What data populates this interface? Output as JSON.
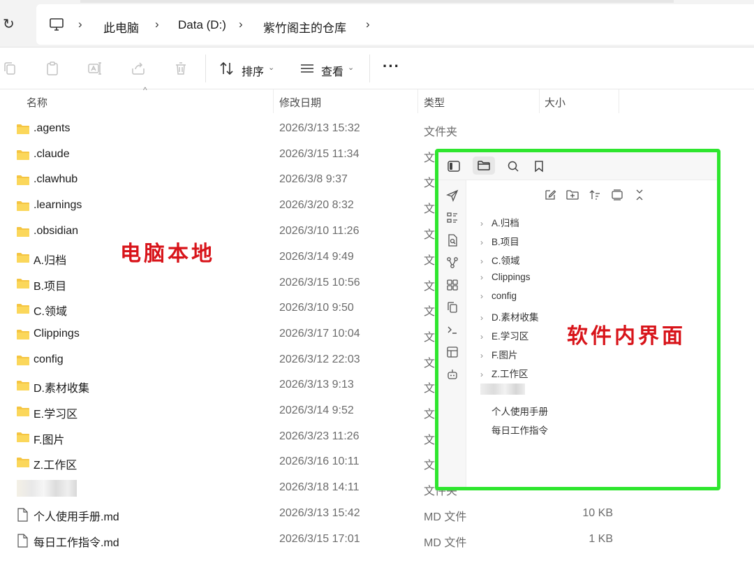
{
  "address": {
    "crumbs": [
      "此电脑",
      "Data (D:)",
      "紫竹阁主的仓库"
    ]
  },
  "toolbar": {
    "sort_label": "排序",
    "view_label": "查看"
  },
  "columns": {
    "name": "名称",
    "modified": "修改日期",
    "type": "类型",
    "size": "大小"
  },
  "rows": [
    {
      "name": ".agents",
      "date": "2026/3/13 15:32",
      "type": "文件夹",
      "size": ""
    },
    {
      "name": ".claude",
      "date": "2026/3/15 11:34",
      "type": "文",
      "size": ""
    },
    {
      "name": ".clawhub",
      "date": "2026/3/8 9:37",
      "type": "文",
      "size": ""
    },
    {
      "name": ".learnings",
      "date": "2026/3/20 8:32",
      "type": "文",
      "size": ""
    },
    {
      "name": ".obsidian",
      "date": "2026/3/10 11:26",
      "type": "文",
      "size": ""
    },
    {
      "name": "A.归档",
      "date": "2026/3/14 9:49",
      "type": "文",
      "size": ""
    },
    {
      "name": "B.项目",
      "date": "2026/3/15 10:56",
      "type": "文",
      "size": ""
    },
    {
      "name": "C.领域",
      "date": "2026/3/10 9:50",
      "type": "文",
      "size": ""
    },
    {
      "name": "Clippings",
      "date": "2026/3/17 10:04",
      "type": "文",
      "size": ""
    },
    {
      "name": "config",
      "date": "2026/3/12 22:03",
      "type": "文",
      "size": ""
    },
    {
      "name": "D.素材收集",
      "date": "2026/3/13 9:13",
      "type": "文",
      "size": ""
    },
    {
      "name": "E.学习区",
      "date": "2026/3/14 9:52",
      "type": "文",
      "size": ""
    },
    {
      "name": "F.图片",
      "date": "2026/3/23 11:26",
      "type": "文",
      "size": ""
    },
    {
      "name": "Z.工作区",
      "date": "2026/3/16 10:11",
      "type": "文",
      "size": ""
    },
    {
      "name": "",
      "date": "2026/3/18 14:11",
      "type": "文件夹",
      "size": ""
    },
    {
      "name": "个人使用手册.md",
      "date": "2026/3/13 15:42",
      "type": "MD 文件",
      "size": "10 KB"
    },
    {
      "name": "每日工作指令.md",
      "date": "2026/3/15 17:01",
      "type": "MD 文件",
      "size": "1 KB"
    }
  ],
  "annotations": {
    "local": "电脑本地",
    "app": "软件内界面"
  },
  "overlay": {
    "folders": [
      "A.归档",
      "B.项目",
      "C.领域",
      "Clippings",
      "config",
      "D.素材收集",
      "E.学习区",
      "F.图片",
      "Z.工作区"
    ],
    "files": [
      "个人使用手册",
      "每日工作指令"
    ],
    "border_color": "#2ee62e"
  },
  "colors": {
    "folder": "#f5c542",
    "annotation": "#d8141a"
  }
}
